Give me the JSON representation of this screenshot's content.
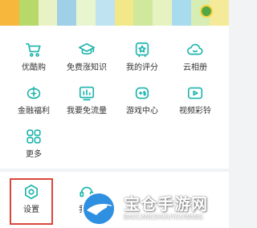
{
  "colors": {
    "accent": "#1fb5ad",
    "highlight": "#d9473b",
    "banner": [
      "#f6b73c",
      "#b6d96a",
      "#e9f2c4",
      "#9fd0e8",
      "#e9f5cf",
      "#bfe3f0",
      "#f2e88a",
      "#cfe89c",
      "#e6f3c1",
      "#a9dbee",
      "#d6edb3",
      "#f4ea9a"
    ]
  },
  "grid": {
    "items": [
      {
        "label": "优酷购",
        "icon": "shopping-cart-icon"
      },
      {
        "label": "免费涨知识",
        "icon": "graduation-cap-icon"
      },
      {
        "label": "我的评分",
        "icon": "star-rating-icon"
      },
      {
        "label": "云相册",
        "icon": "cloud-icon"
      },
      {
        "label": "金融福利",
        "icon": "piggy-bank-icon"
      },
      {
        "label": "我要免流量",
        "icon": "data-traffic-icon"
      },
      {
        "label": "游戏中心",
        "icon": "gamepad-icon"
      },
      {
        "label": "视频彩铃",
        "icon": "video-ringtone-icon"
      },
      {
        "label": "更多",
        "icon": "more-grid-icon"
      }
    ]
  },
  "bottom": {
    "items": [
      {
        "label": "设置",
        "icon": "settings-icon"
      },
      {
        "label": "我的",
        "icon": "support-icon"
      }
    ]
  },
  "watermark": {
    "title": "宝仓手游网",
    "subtitle": "BAOCANGSHOUYOUWANG"
  }
}
